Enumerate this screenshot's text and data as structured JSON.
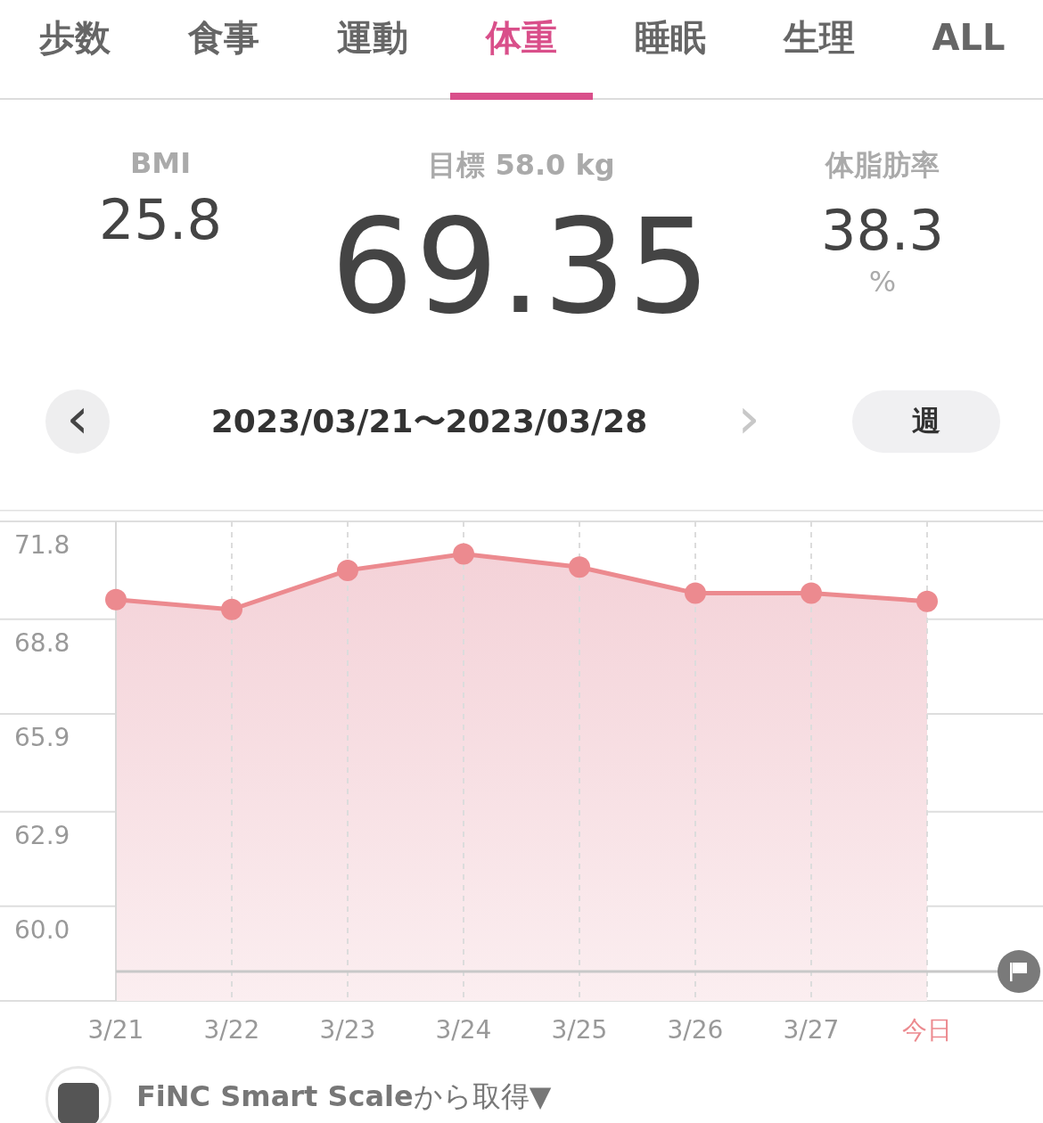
{
  "tabs": [
    {
      "label": "歩数",
      "selected": false
    },
    {
      "label": "食事",
      "selected": false
    },
    {
      "label": "運動",
      "selected": false
    },
    {
      "label": "体重",
      "selected": true
    },
    {
      "label": "睡眠",
      "selected": false
    },
    {
      "label": "生理",
      "selected": false
    },
    {
      "label": "ALL",
      "selected": false
    }
  ],
  "stats": {
    "bmi": {
      "label": "BMI",
      "value": "25.8"
    },
    "goal": {
      "label": "目標 58.0 kg",
      "value": "69.35"
    },
    "body_fat": {
      "label": "体脂肪率",
      "value": "38.3",
      "unit": "%"
    }
  },
  "date_nav": {
    "prev": "‹",
    "range": "2023/03/21〜2023/03/28",
    "next": "›",
    "period": "週"
  },
  "chart": {
    "highlight_last": true,
    "chart_data": {
      "type": "area",
      "categories": [
        "3/21",
        "3/22",
        "3/23",
        "3/24",
        "3/25",
        "3/26",
        "3/27",
        "今日"
      ],
      "grid": true,
      "series": [
        {
          "color": "#ec8a8f",
          "values": [
            69.4,
            69.1,
            70.3,
            70.8,
            70.4,
            69.6,
            69.6,
            69.35
          ]
        }
      ],
      "ylim": [
        57.1,
        71.8
      ],
      "yticks": [
        71.8,
        68.8,
        65.9,
        62.9,
        {
          "value": 60,
          "label": "60.0"
        }
      ],
      "ref_lines": [
        {
          "axis": "y",
          "value": 58.0
        }
      ]
    }
  },
  "source": {
    "text": "**FiNC Smart Scale**から取得▼"
  }
}
